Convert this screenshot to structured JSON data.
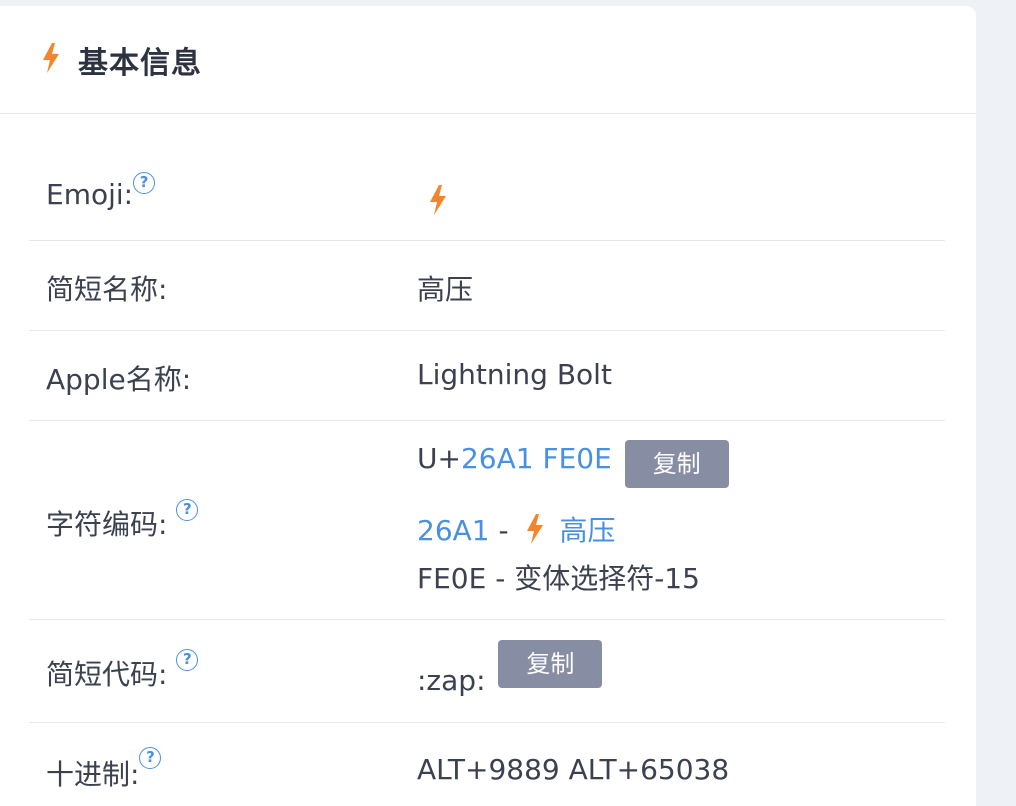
{
  "header": {
    "title": "基本信息",
    "icon": "lightning-bolt-icon"
  },
  "rows": {
    "emoji": {
      "label": "Emoji:",
      "help_icon": "?"
    },
    "short_name": {
      "label": "简短名称:",
      "value": "高压"
    },
    "apple_name": {
      "label": "Apple名称:",
      "value": "Lightning Bolt"
    },
    "codepoint": {
      "label": "字符编码:",
      "help_icon": "?",
      "prefix": "U+",
      "code": "26A1 FE0E",
      "copy_label": "复制",
      "line2_code": "26A1",
      "line2_sep": " - ",
      "line2_name": "高压",
      "line3": "FE0E - 变体选择符-15"
    },
    "shortcode": {
      "label": "简短代码:",
      "help_icon": "?",
      "value": ":zap:",
      "copy_label": "复制"
    },
    "decimal": {
      "label": "十进制:",
      "help_icon": "?",
      "value": "ALT+9889 ALT+65038"
    }
  },
  "colors": {
    "accent": "#4a90e2",
    "bolt": "#f5842b",
    "button": "#878da2"
  }
}
